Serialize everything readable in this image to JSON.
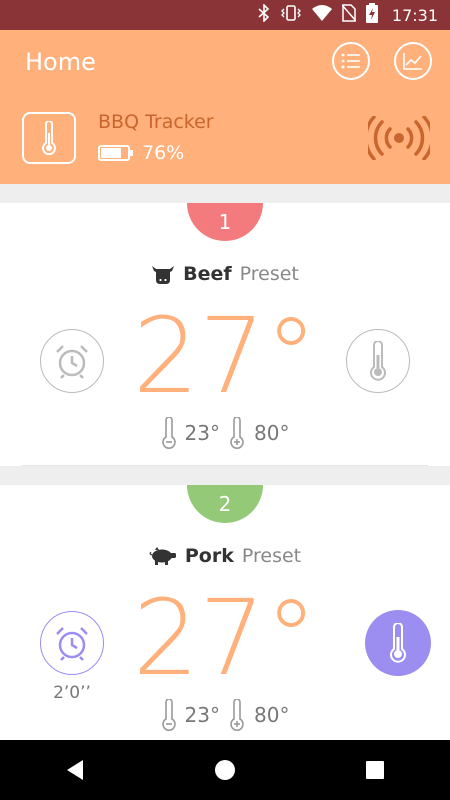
{
  "status_bar": {
    "time": "17:31"
  },
  "header": {
    "title": "Home"
  },
  "device": {
    "name": "BBQ Tracker",
    "battery": "76%",
    "battery_level": 0.76
  },
  "probes": [
    {
      "number": "1",
      "badge_color": "#f37a7d",
      "meat": "Beef",
      "preset": "Preset",
      "temp": "27°",
      "min": "23°",
      "max": "80°",
      "alarm_active": false,
      "timer": ""
    },
    {
      "number": "2",
      "badge_color": "#94c977",
      "meat": "Pork",
      "preset": "Preset",
      "temp": "27°",
      "min": "23°",
      "max": "80°",
      "alarm_active": true,
      "timer": "2’0’’"
    }
  ],
  "colors": {
    "accent": "#ffb07b",
    "status_bar": "#8a3438",
    "active": "#9c8df0"
  }
}
